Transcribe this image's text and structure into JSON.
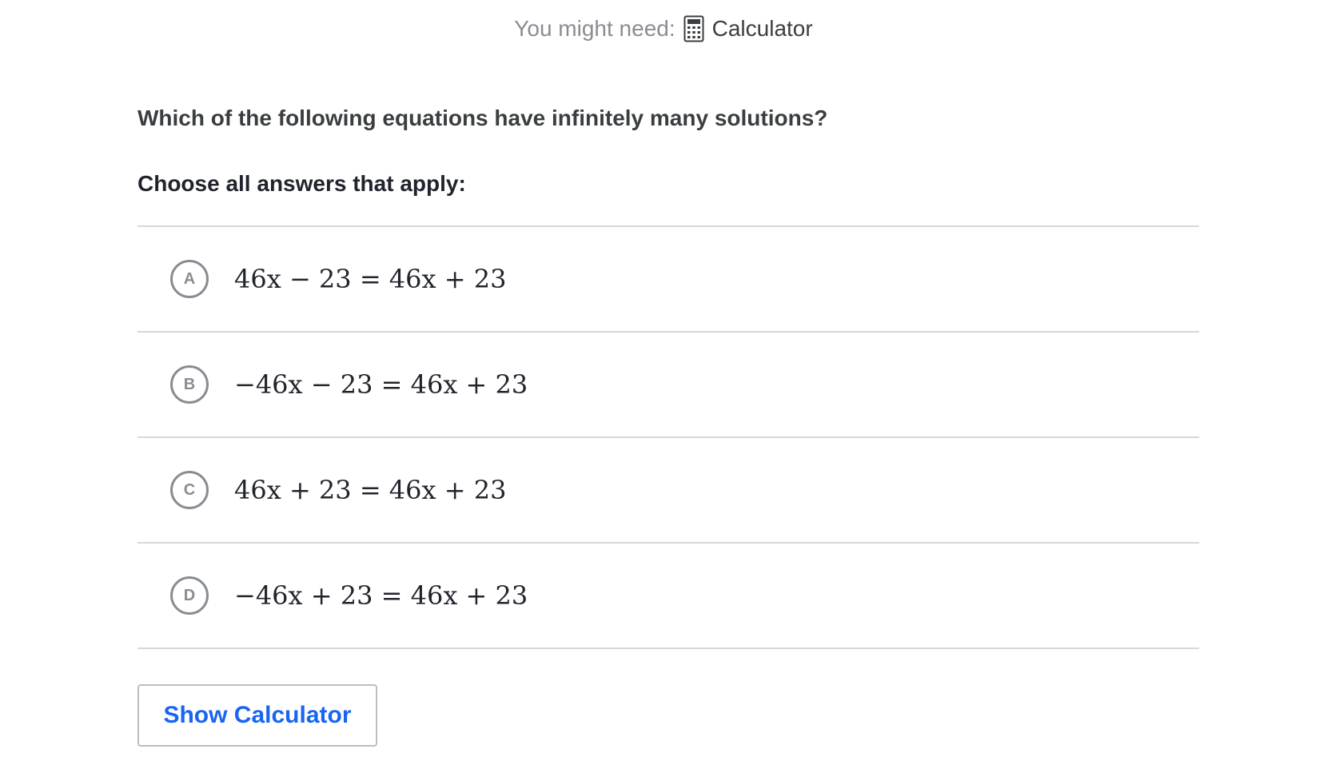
{
  "hint": {
    "prefix": "You might need:",
    "tool_icon": "calculator-icon",
    "tool_label": "Calculator"
  },
  "question": {
    "prompt": "Which of the following equations have infinitely many solutions?",
    "instructions": "Choose all answers that apply:"
  },
  "choices": [
    {
      "letter": "A",
      "equation": "46x − 23 = 46x + 23"
    },
    {
      "letter": "B",
      "equation": "−46x − 23 = 46x + 23"
    },
    {
      "letter": "C",
      "equation": "46x + 23 = 46x + 23"
    },
    {
      "letter": "D",
      "equation": "−46x + 23 = 46x + 23"
    }
  ],
  "actions": {
    "show_calculator_label": "Show Calculator"
  },
  "colors": {
    "accent": "#1865f2",
    "muted_text": "#888d93",
    "divider": "#d6d8da"
  }
}
